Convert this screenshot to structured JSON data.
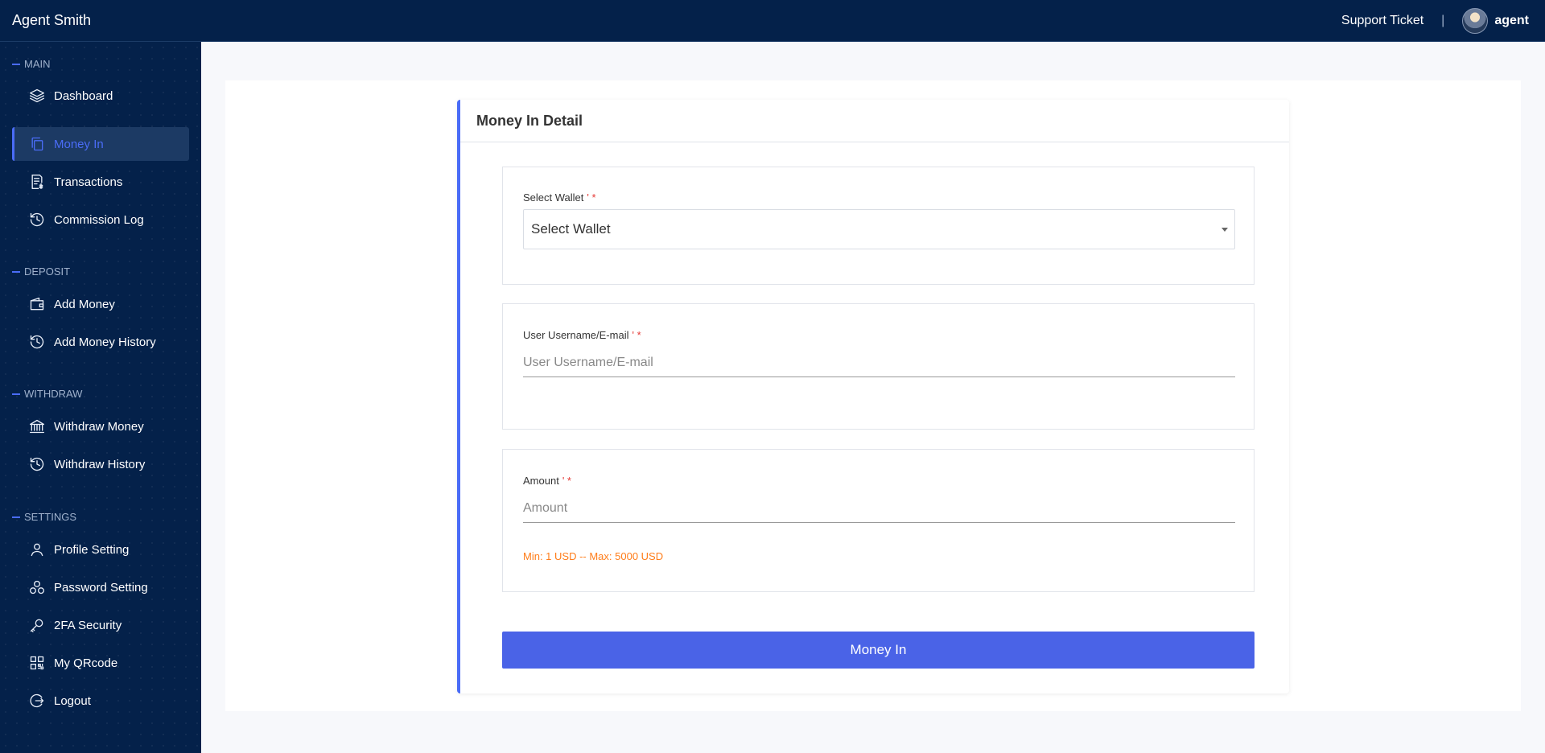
{
  "app": {
    "brand": "Agent Smith",
    "support_label": "Support Ticket",
    "separator": "|",
    "username": "agent"
  },
  "sidebar": {
    "sections": [
      {
        "label": "MAIN"
      },
      {
        "label": "DEPOSIT"
      },
      {
        "label": "WITHDRAW"
      },
      {
        "label": "SETTINGS"
      }
    ],
    "items": [
      {
        "label": "Dashboard",
        "icon": "layers-icon"
      },
      {
        "label": "Money In",
        "icon": "copy-icon",
        "active": true
      },
      {
        "label": "Transactions",
        "icon": "receipt-icon"
      },
      {
        "label": "Commission Log",
        "icon": "history-icon"
      },
      {
        "label": "Add Money",
        "icon": "wallet-icon"
      },
      {
        "label": "Add Money History",
        "icon": "history-icon"
      },
      {
        "label": "Withdraw Money",
        "icon": "bank-icon"
      },
      {
        "label": "Withdraw History",
        "icon": "history-icon"
      },
      {
        "label": "Profile Setting",
        "icon": "user-icon"
      },
      {
        "label": "Password Setting",
        "icon": "circles-icon"
      },
      {
        "label": "2FA Security",
        "icon": "key-icon"
      },
      {
        "label": "My QRcode",
        "icon": "qrcode-icon"
      },
      {
        "label": "Logout",
        "icon": "logout-icon"
      }
    ],
    "accent_color": "#4a6cf7",
    "background_color": "#04214a"
  },
  "form": {
    "title": "Money In Detail",
    "wallet": {
      "label": "Select Wallet",
      "label_mark": "' *",
      "selected": "Select Wallet"
    },
    "user": {
      "label": "User Username/E-mail",
      "label_mark": "' *",
      "placeholder": "User Username/E-mail"
    },
    "amount": {
      "label": "Amount",
      "label_mark": "' *",
      "placeholder": "Amount",
      "hint": "Min: 1 USD -- Max: 5000 USD"
    },
    "submit_label": "Money In",
    "button_color": "#4a63e7",
    "hint_color": "#ff7d1a"
  }
}
